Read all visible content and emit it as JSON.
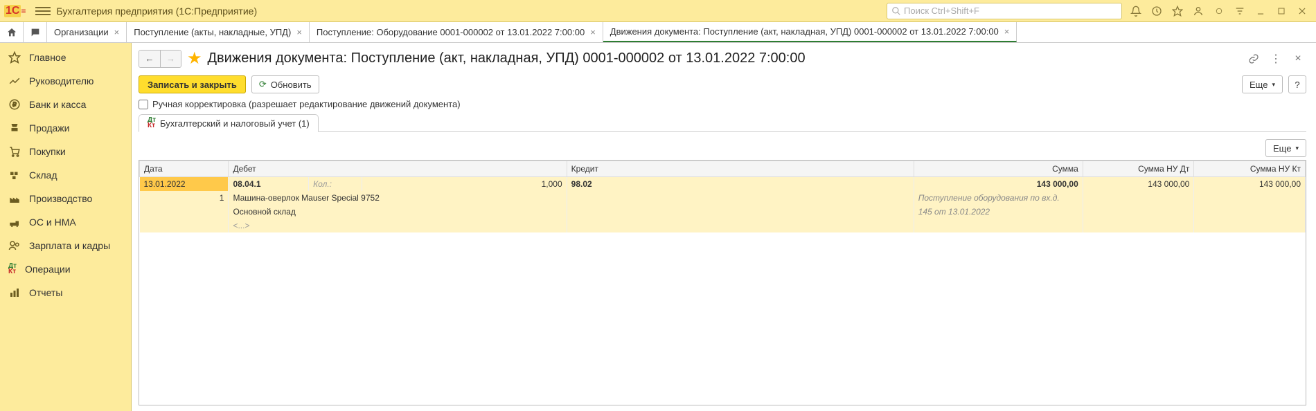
{
  "titlebar": {
    "app_title": "Бухгалтерия предприятия  (1С:Предприятие)",
    "search_placeholder": "Поиск Ctrl+Shift+F"
  },
  "tabs": [
    {
      "label": "Организации"
    },
    {
      "label": "Поступление (акты, накладные, УПД)"
    },
    {
      "label": "Поступление: Оборудование 0001-000002 от 13.01.2022 7:00:00"
    },
    {
      "label": "Движения документа: Поступление (акт, накладная, УПД) 0001-000002 от 13.01.2022 7:00:00",
      "active": true
    }
  ],
  "sidebar": {
    "items": [
      {
        "label": "Главное"
      },
      {
        "label": "Руководителю"
      },
      {
        "label": "Банк и касса"
      },
      {
        "label": "Продажи"
      },
      {
        "label": "Покупки"
      },
      {
        "label": "Склад"
      },
      {
        "label": "Производство"
      },
      {
        "label": "ОС и НМА"
      },
      {
        "label": "Зарплата и кадры"
      },
      {
        "label": "Операции"
      },
      {
        "label": "Отчеты"
      }
    ]
  },
  "document": {
    "title": "Движения документа: Поступление (акт, накладная, УПД) 0001-000002 от 13.01.2022 7:00:00",
    "save_close_label": "Записать и закрыть",
    "refresh_label": "Обновить",
    "more_label": "Еще",
    "help_label": "?",
    "manual_edit_label": "Ручная корректировка (разрешает редактирование движений документа)",
    "inner_tab_label": "Бухгалтерский и налоговый учет (1)"
  },
  "table": {
    "headers": {
      "date": "Дата",
      "debit": "Дебет",
      "credit": "Кредит",
      "sum": "Сумма",
      "sum_nu_dt": "Сумма НУ Дт",
      "sum_nu_kt": "Сумма НУ Кт"
    },
    "row": {
      "date": "13.01.2022",
      "num": "1",
      "debit_acc": "08.04.1",
      "kol_label": "Кол.:",
      "kol_value": "1,000",
      "credit_acc": "98.02",
      "sum": "143 000,00",
      "sum_nu_dt": "143 000,00",
      "sum_nu_kt": "143 000,00",
      "subkonto1": "Машина-оверлок Mauser Special 9752",
      "subkonto2": "Основной склад",
      "subkonto3": "<...>",
      "comment_line1": "Поступление оборудования по вх.д.",
      "comment_line2": "145 от 13.01.2022"
    }
  }
}
